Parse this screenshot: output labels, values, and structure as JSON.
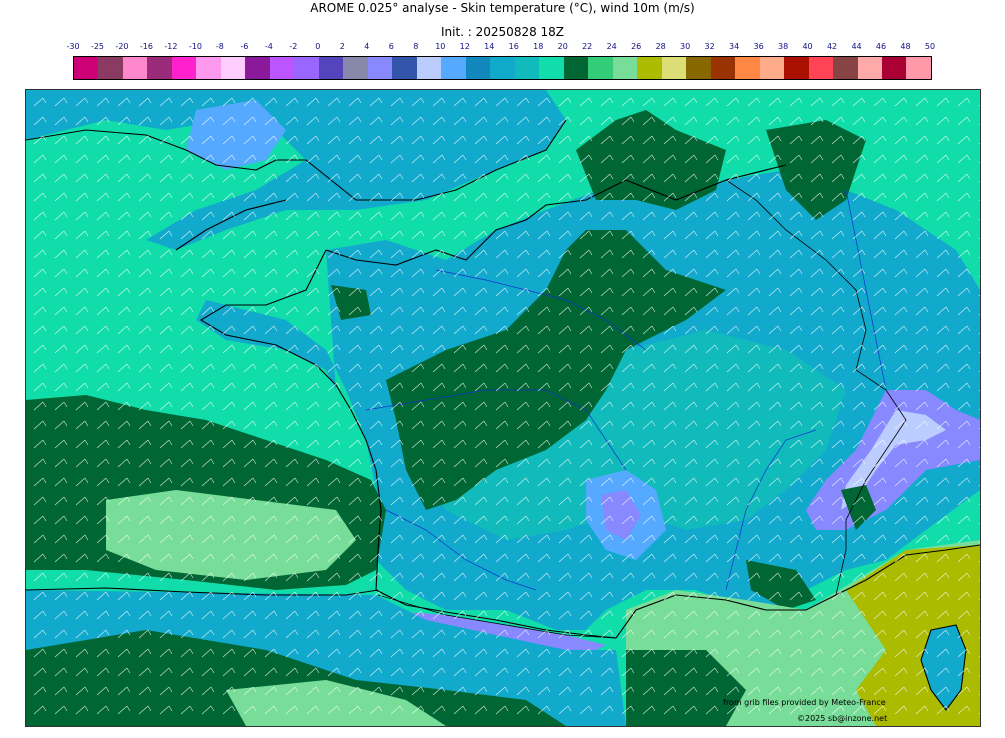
{
  "header": {
    "title": "AROME 0.025° analyse - Skin temperature (°C), wind 10m (m/s)",
    "init": "Init. : 20250828 18Z"
  },
  "colorbar": {
    "ticks": [
      "-30",
      "-25",
      "-20",
      "-16",
      "-12",
      "-10",
      "-8",
      "-6",
      "-4",
      "-2",
      "0",
      "2",
      "4",
      "6",
      "8",
      "10",
      "12",
      "14",
      "16",
      "18",
      "20",
      "22",
      "24",
      "26",
      "28",
      "30",
      "32",
      "34",
      "36",
      "38",
      "40",
      "42",
      "44",
      "46",
      "48",
      "50"
    ],
    "colors": [
      "#cc0077",
      "#8b3a62",
      "#ff88cc",
      "#9b2a7a",
      "#ff22cc",
      "#ff99ee",
      "#ffccff",
      "#8b1a9b",
      "#bb55ff",
      "#9966ff",
      "#5544bb",
      "#8888aa",
      "#8888ff",
      "#3355aa",
      "#bbccff",
      "#55aaff",
      "#1188bb",
      "#11aacc",
      "#11bbbb",
      "#11ddaa",
      "#006633",
      "#33cc77",
      "#77dd99",
      "#aabb00",
      "#dddd77",
      "#886600",
      "#993300",
      "#ff8844",
      "#ffaa88",
      "#aa1100",
      "#ff4455",
      "#884444",
      "#ffaaaa",
      "#aa0033",
      "#ff99aa"
    ]
  },
  "map": {
    "region": "France",
    "palette": {
      "sea": "#11ddaa",
      "warm": "#006633",
      "mild": "#11bbbb",
      "cool": "#11aacc",
      "cold": "#55aaff",
      "mountain": "#8888ff",
      "peak": "#bbccff",
      "hot": "#77dd99",
      "veryhot": "#aabb00",
      "coast": "#000000",
      "river": "#1133cc",
      "barb": "#ffffff"
    }
  },
  "credits": {
    "source": "from grib files provided by Meteo-France",
    "copyright": "©2025 sb@inzone.net"
  }
}
